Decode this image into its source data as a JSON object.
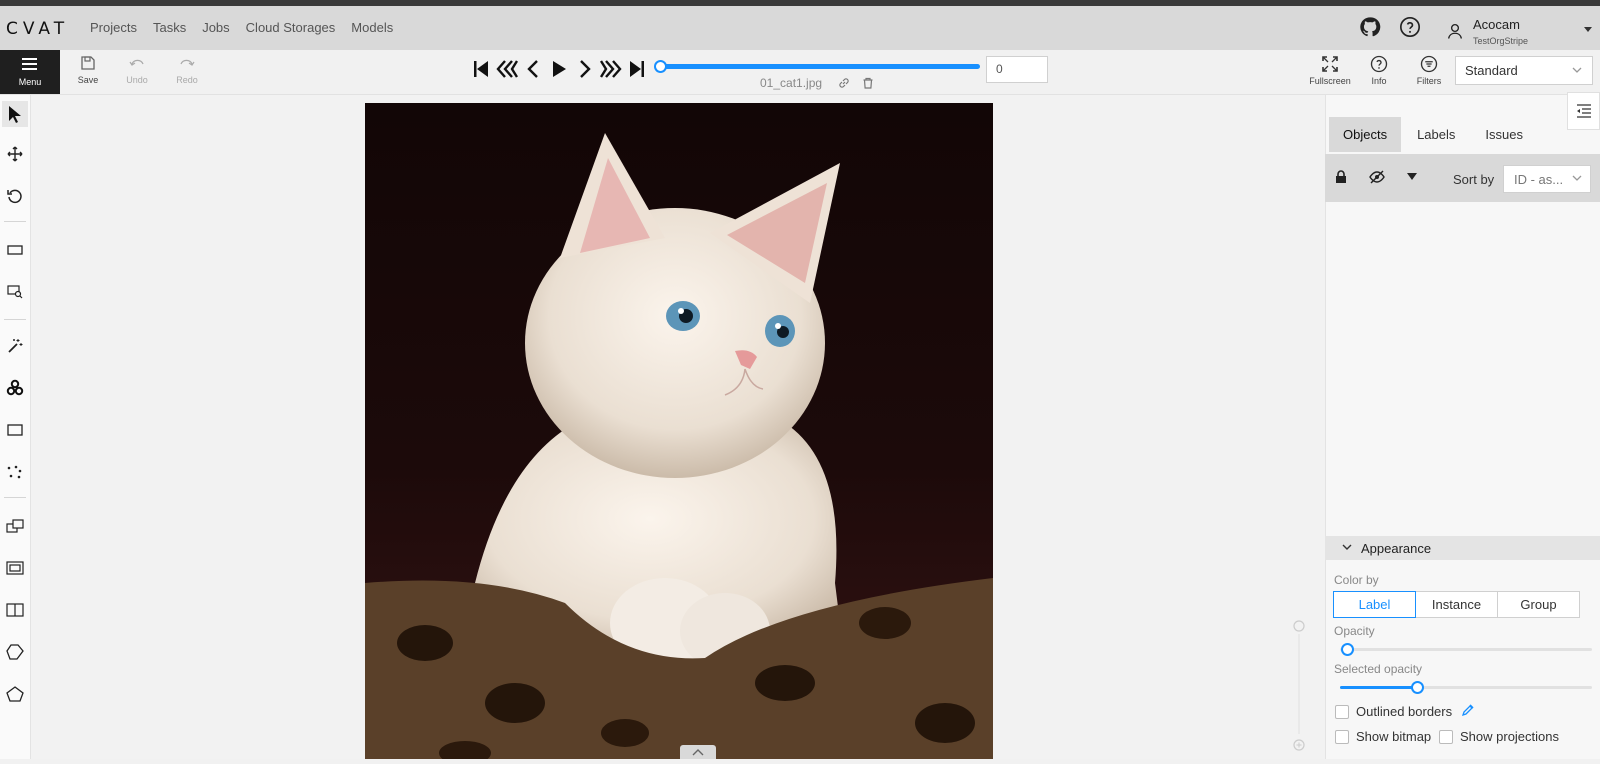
{
  "app": {
    "logo": "CVAT"
  },
  "nav": {
    "items": [
      "Projects",
      "Tasks",
      "Jobs",
      "Cloud Storages",
      "Models"
    ]
  },
  "header_icons": [
    "github-icon",
    "help-icon"
  ],
  "user": {
    "name": "Acocam",
    "org": "TestOrgStripe"
  },
  "toolbar": {
    "menu_label": "Menu",
    "save_label": "Save",
    "undo_label": "Undo",
    "redo_label": "Redo",
    "frame_number": "0",
    "filename": "01_cat1.jpg",
    "player_progress": 0,
    "fullscreen_label": "Fullscreen",
    "info_label": "Info",
    "filters_label": "Filters",
    "workspace": "Standard"
  },
  "left_tools": [
    "cursor-icon",
    "move-icon",
    "rotate-icon",
    "fit-icon",
    "zoom-region-icon",
    "magic-wand-icon",
    "openvino-icon",
    "rectangle-icon",
    "points-icon",
    "merge-icon",
    "group-icon",
    "split-icon",
    "polygon-icon",
    "polygon-alt-icon"
  ],
  "sidebar": {
    "tabs": [
      "Objects",
      "Labels",
      "Issues"
    ],
    "active_tab": "Objects",
    "sort_by_label": "Sort by",
    "sort_value": "ID - as...",
    "appearance": {
      "title": "Appearance",
      "color_by_label": "Color by",
      "color_by_options": [
        "Label",
        "Instance",
        "Group"
      ],
      "color_by_selected": "Label",
      "opacity_label": "Opacity",
      "opacity_value": 0,
      "selected_opacity_label": "Selected opacity",
      "selected_opacity_value": 0.3,
      "outlined_borders_label": "Outlined borders",
      "show_bitmap_label": "Show bitmap",
      "show_projections_label": "Show projections"
    }
  },
  "colors": {
    "accent": "#1890ff",
    "menu_bg": "#1f1f1f",
    "header_bg": "#d9d9d9"
  }
}
